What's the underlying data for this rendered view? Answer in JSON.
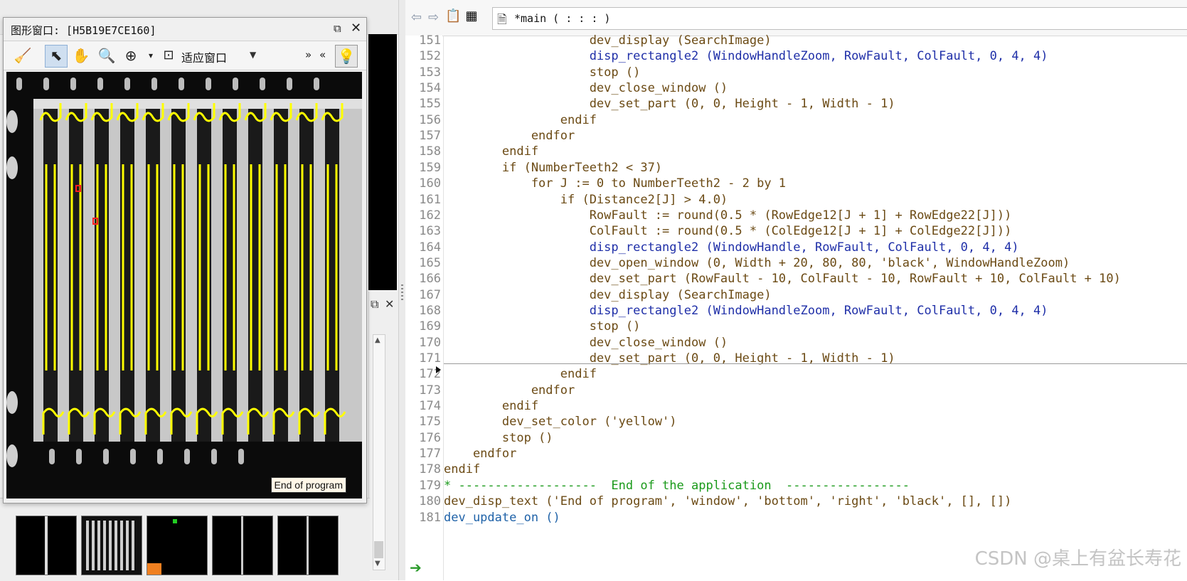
{
  "graphics_window": {
    "title": "图形窗口: [H5B19E7CE160]",
    "fit_option": "适应窗口",
    "end_tip": "End of program"
  },
  "editor": {
    "procedure_tab": "*main ( : : : )",
    "lines": [
      {
        "n": "151",
        "text": "                    dev_display (SearchImage)",
        "kind": "code"
      },
      {
        "n": "152",
        "text": "                    disp_rectangle2 (WindowHandleZoom, RowFault, ColFault, 0, 4, 4)",
        "kind": "op"
      },
      {
        "n": "153",
        "text": "                    stop ()",
        "kind": "code"
      },
      {
        "n": "154",
        "text": "                    dev_close_window ()",
        "kind": "code"
      },
      {
        "n": "155",
        "text": "                    dev_set_part (0, 0, Height - 1, Width - 1)",
        "kind": "code"
      },
      {
        "n": "156",
        "text": "                endif",
        "kind": "code"
      },
      {
        "n": "157",
        "text": "            endfor",
        "kind": "code"
      },
      {
        "n": "158",
        "text": "        endif",
        "kind": "code"
      },
      {
        "n": "159",
        "text": "        if (NumberTeeth2 < 37)",
        "kind": "code"
      },
      {
        "n": "160",
        "text": "            for J := 0 to NumberTeeth2 - 2 by 1",
        "kind": "code"
      },
      {
        "n": "161",
        "text": "                if (Distance2[J] > 4.0)",
        "kind": "code"
      },
      {
        "n": "162",
        "text": "                    RowFault := round(0.5 * (RowEdge12[J + 1] + RowEdge22[J]))",
        "kind": "code"
      },
      {
        "n": "163",
        "text": "                    ColFault := round(0.5 * (ColEdge12[J + 1] + ColEdge22[J]))",
        "kind": "code"
      },
      {
        "n": "164",
        "text": "                    disp_rectangle2 (WindowHandle, RowFault, ColFault, 0, 4, 4)",
        "kind": "op"
      },
      {
        "n": "165",
        "text": "                    dev_open_window (0, Width + 20, 80, 80, 'black', WindowHandleZoom)",
        "kind": "code"
      },
      {
        "n": "166",
        "text": "                    dev_set_part (RowFault - 10, ColFault - 10, RowFault + 10, ColFault + 10)",
        "kind": "code"
      },
      {
        "n": "167",
        "text": "                    dev_display (SearchImage)",
        "kind": "code"
      },
      {
        "n": "168",
        "text": "                    disp_rectangle2 (WindowHandleZoom, RowFault, ColFault, 0, 4, 4)",
        "kind": "op"
      },
      {
        "n": "169",
        "text": "                    stop ()",
        "kind": "code"
      },
      {
        "n": "170",
        "text": "                    dev_close_window ()",
        "kind": "code"
      },
      {
        "n": "171",
        "text": "                    dev_set_part (0, 0, Height - 1, Width - 1)",
        "kind": "code"
      },
      {
        "n": "172",
        "text": "                endif",
        "kind": "code"
      },
      {
        "n": "173",
        "text": "            endfor",
        "kind": "code"
      },
      {
        "n": "174",
        "text": "        endif",
        "kind": "code"
      },
      {
        "n": "175",
        "text": "        dev_set_color ('yellow')",
        "kind": "code"
      },
      {
        "n": "176",
        "text": "        stop ()",
        "kind": "code"
      },
      {
        "n": "177",
        "text": "    endfor",
        "kind": "code"
      },
      {
        "n": "178",
        "text": "endif",
        "kind": "code"
      },
      {
        "n": "179",
        "text": "* -------------------  End of the application  -----------------",
        "kind": "cmt"
      },
      {
        "n": "180",
        "text": "dev_disp_text ('End of program', 'window', 'bottom', 'right', 'black', [], [])",
        "kind": "code"
      },
      {
        "n": "181",
        "text": "dev_update_on ()",
        "kind": "upd"
      }
    ]
  },
  "watermark": "CSDN @桌上有盆长寿花",
  "colors": {
    "code_text": "#6b4a14",
    "operator_text": "#1f2fa8",
    "comment_text": "#1a9a1a",
    "highlight_yellow": "#ffff00"
  }
}
